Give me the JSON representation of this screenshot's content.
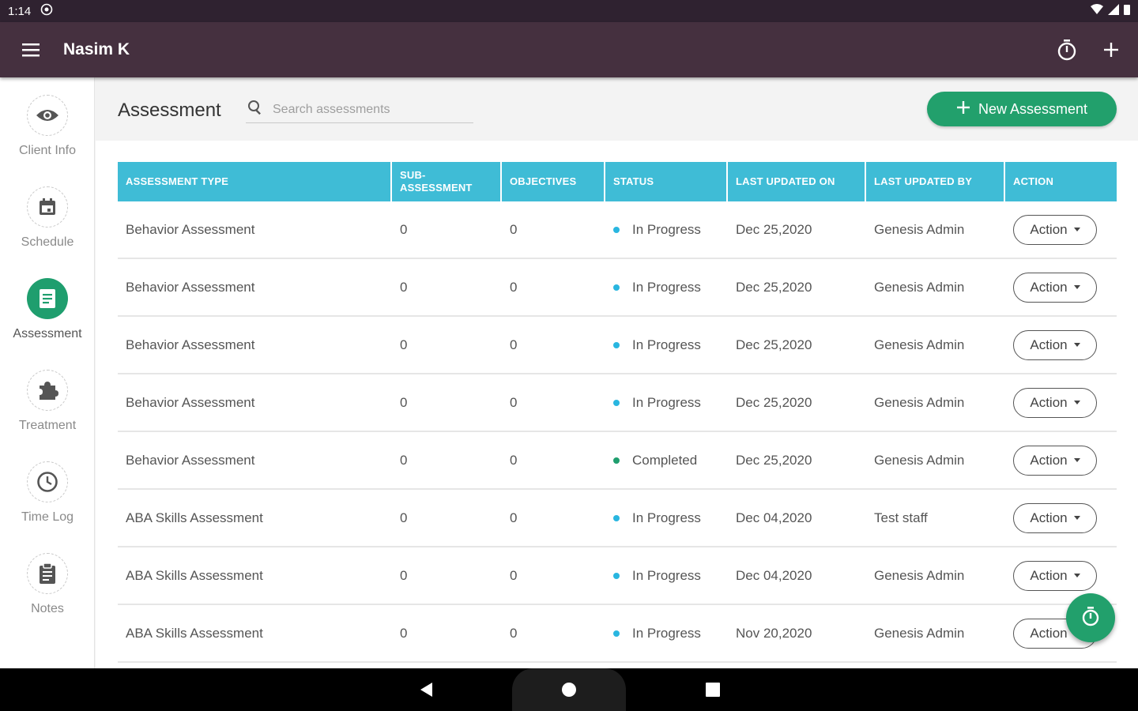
{
  "status_bar": {
    "time": "1:14"
  },
  "app_bar": {
    "title": "Nasim K"
  },
  "sidebar": {
    "items": [
      {
        "label": "Client Info",
        "icon": "eye-icon",
        "active": false
      },
      {
        "label": "Schedule",
        "icon": "calendar-icon",
        "active": false
      },
      {
        "label": "Assessment",
        "icon": "document-icon",
        "active": true
      },
      {
        "label": "Treatment",
        "icon": "puzzle-icon",
        "active": false
      },
      {
        "label": "Time Log",
        "icon": "clock-icon",
        "active": false
      },
      {
        "label": "Notes",
        "icon": "clipboard-icon",
        "active": false
      }
    ]
  },
  "main": {
    "title": "Assessment",
    "search": {
      "placeholder": "Search assessments",
      "value": ""
    },
    "new_button_label": "New Assessment"
  },
  "table": {
    "headers": [
      "ASSESSMENT TYPE",
      "SUB-ASSESSMENT",
      "OBJECTIVES",
      "STATUS",
      "LAST UPDATED ON",
      "LAST UPDATED BY",
      "ACTION"
    ],
    "rows": [
      {
        "type": "Behavior Assessment",
        "sub": "0",
        "objectives": "0",
        "status": "In Progress",
        "updated_on": "Dec 25,2020",
        "updated_by": "Genesis Admin",
        "action": "Action"
      },
      {
        "type": "Behavior Assessment",
        "sub": "0",
        "objectives": "0",
        "status": "In Progress",
        "updated_on": "Dec 25,2020",
        "updated_by": "Genesis Admin",
        "action": "Action"
      },
      {
        "type": "Behavior Assessment",
        "sub": "0",
        "objectives": "0",
        "status": "In Progress",
        "updated_on": "Dec 25,2020",
        "updated_by": "Genesis Admin",
        "action": "Action"
      },
      {
        "type": "Behavior Assessment",
        "sub": "0",
        "objectives": "0",
        "status": "In Progress",
        "updated_on": "Dec 25,2020",
        "updated_by": "Genesis Admin",
        "action": "Action"
      },
      {
        "type": "Behavior Assessment",
        "sub": "0",
        "objectives": "0",
        "status": "Completed",
        "updated_on": "Dec 25,2020",
        "updated_by": "Genesis Admin",
        "action": "Action"
      },
      {
        "type": "ABA Skills Assessment",
        "sub": "0",
        "objectives": "0",
        "status": "In Progress",
        "updated_on": "Dec 04,2020",
        "updated_by": "Test staff",
        "action": "Action"
      },
      {
        "type": "ABA Skills Assessment",
        "sub": "0",
        "objectives": "0",
        "status": "In Progress",
        "updated_on": "Dec 04,2020",
        "updated_by": "Genesis Admin",
        "action": "Action"
      },
      {
        "type": "ABA Skills Assessment",
        "sub": "0",
        "objectives": "0",
        "status": "In Progress",
        "updated_on": "Nov 20,2020",
        "updated_by": "Genesis Admin",
        "action": "Action"
      }
    ]
  },
  "colors": {
    "app_bar": "#45303f",
    "accent_green": "#22a06c",
    "table_header": "#3fbcd6",
    "status_in_progress": "#29b6e0",
    "status_completed": "#1f9e6e"
  }
}
